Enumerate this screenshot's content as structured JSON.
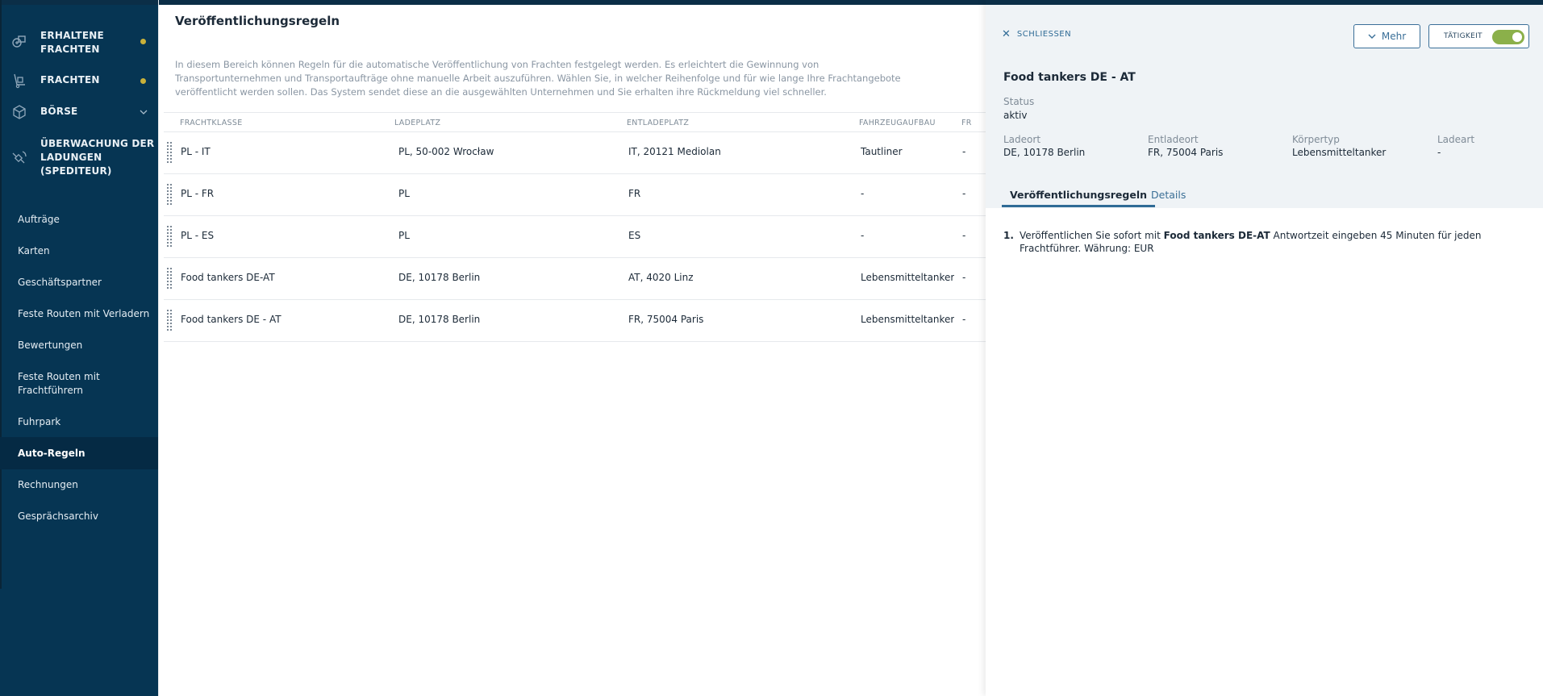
{
  "sidebar": {
    "major": [
      {
        "label": "ERHALTENE FRACHTEN",
        "line1": "ERHALTENE",
        "line2": "FRACHTEN",
        "icon": "received-freight-icon",
        "dot": true
      },
      {
        "label": "FRACHTEN",
        "line1": "FRACHTEN",
        "icon": "freight-dolly-icon",
        "dot": true
      },
      {
        "label": "BÖRSE",
        "line1": "BÖRSE",
        "icon": "exchange-box-icon",
        "chevron": "chevron-down-icon"
      },
      {
        "label": "ÜBERWACHUNG DER LADUNGEN (SPEDITEUR)",
        "line1": "ÜBERWACHUNG DER",
        "line2": "LADUNGEN",
        "line3": "(SPEDITEUR)",
        "icon": "satellite-icon"
      }
    ],
    "minor": [
      {
        "label": "Aufträge"
      },
      {
        "label": "Karten"
      },
      {
        "label": "Geschäftspartner"
      },
      {
        "label": "Feste Routen mit Verladern"
      },
      {
        "label": "Bewertungen"
      },
      {
        "label": "Feste Routen mit Frachtführern",
        "line1": "Feste Routen mit",
        "line2": "Frachtführern"
      },
      {
        "label": "Fuhrpark"
      },
      {
        "label": "Auto-Regeln",
        "active": true
      },
      {
        "label": "Rechnungen"
      },
      {
        "label": "Gesprächsarchiv"
      }
    ]
  },
  "main": {
    "title": "Veröffentlichungsregeln",
    "description": "In diesem Bereich können Regeln für die automatische Veröffentlichung von Frachten festgelegt werden. Es erleichtert die Gewinnung von Transportunternehmen und Transportaufträge ohne manuelle Arbeit auszuführen. Wählen Sie, in welcher Reihenfolge und für wie lange Ihre Frachtangebote veröffentlicht werden sollen. Das System sendet diese an die ausgewählten Unternehmen und Sie erhalten ihre Rückmeldung viel schneller.",
    "columns": [
      "FRACHTKLASSE",
      "LADEPLATZ",
      "ENTLADEPLATZ",
      "FAHRZEUGAUFBAU",
      "FR"
    ],
    "rows": [
      [
        "PL - IT",
        "PL, 50-002 Wrocław",
        "IT, 20121 Mediolan",
        "Tautliner",
        "-"
      ],
      [
        "PL - FR",
        "PL",
        "FR",
        "-",
        "-"
      ],
      [
        "PL - ES",
        "PL",
        "ES",
        "-",
        "-"
      ],
      [
        "Food tankers DE-AT",
        "DE, 10178 Berlin",
        "AT, 4020 Linz",
        "Lebensmitteltanker",
        "-"
      ],
      [
        "Food tankers DE - AT",
        "DE, 10178 Berlin",
        "FR, 75004 Paris",
        "Lebensmitteltanker",
        "-"
      ]
    ]
  },
  "panel": {
    "close_label": "SCHLIESSEN",
    "more_label": "Mehr",
    "activity_label": "TÄTIGKEIT",
    "activity_on": true,
    "title": "Food tankers DE - AT",
    "status_label": "Status",
    "status_value": "aktiv",
    "fields": [
      {
        "label": "Ladeort",
        "value": "DE, 10178 Berlin"
      },
      {
        "label": "Entladeort",
        "value": "FR, 75004 Paris"
      },
      {
        "label": "Körpertyp",
        "value": "Lebensmitteltanker"
      },
      {
        "label": "Ladeart",
        "value": "-"
      }
    ],
    "tabs": [
      {
        "label": "Veröffentlichungsregeln",
        "active": true
      },
      {
        "label": "Details",
        "active": false
      }
    ],
    "rules": [
      {
        "number": "1.",
        "prefix": "Veröffentlichen Sie sofort mit",
        "bold": "Food tankers DE-AT",
        "suffix": "Antwortzeit eingeben 45 Minuten für jeden Frachtführer. Währung: EUR"
      }
    ]
  },
  "colors": {
    "sidebar_bg": "#063553",
    "accent": "#2f6b96",
    "dot": "#c9b13a",
    "toggle_on": "#8bb04a"
  }
}
